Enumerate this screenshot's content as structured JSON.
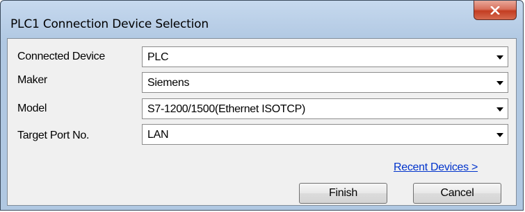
{
  "window": {
    "title": "PLC1 Connection Device Selection"
  },
  "fields": [
    {
      "label": "Connected Device",
      "value": "PLC"
    },
    {
      "label": "Maker",
      "value": "Siemens"
    },
    {
      "label": "Model",
      "value": "S7-1200/1500(Ethernet ISOTCP)"
    },
    {
      "label": "Target Port No.",
      "value": "LAN"
    }
  ],
  "links": {
    "recent_devices": "Recent Devices >"
  },
  "buttons": {
    "finish": "Finish",
    "cancel": "Cancel"
  },
  "icons": {
    "close": "close-icon",
    "dropdown": "chevron-down-icon"
  },
  "colors": {
    "close_button": "#c94a31",
    "link": "#0033cc",
    "title_bar": "#b7cde6"
  }
}
